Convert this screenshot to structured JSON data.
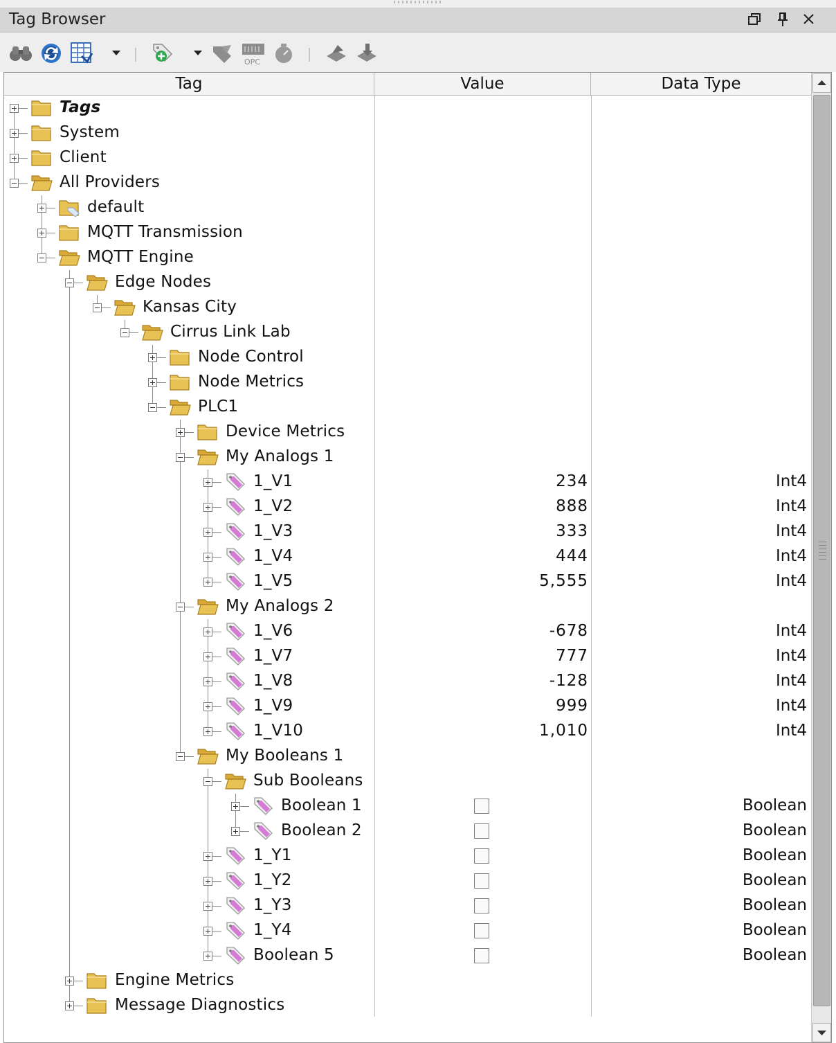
{
  "window": {
    "title": "Tag Browser"
  },
  "toolbar": {
    "buttons": [
      "binoculars-icon",
      "refresh-icon",
      "edit-table-icon",
      "add-tag-icon",
      "tag-filter-icon",
      "opc-browser-icon",
      "timer-icon",
      "import-icon",
      "export-icon"
    ]
  },
  "columns": {
    "tag": "Tag",
    "value": "Value",
    "data_type": "Data Type"
  },
  "colors": {
    "folder": "#e8c254",
    "tag_icon": "#d77ad7",
    "scrollbar": "#b7b7b7"
  },
  "rows": [
    {
      "label": "Tags",
      "depth": 0,
      "expanded": false,
      "icon": "folder",
      "italic": true
    },
    {
      "label": "System",
      "depth": 0,
      "expanded": false,
      "icon": "folder"
    },
    {
      "label": "Client",
      "depth": 0,
      "expanded": false,
      "icon": "folder"
    },
    {
      "label": "All Providers",
      "depth": 0,
      "expanded": true,
      "icon": "open-folder"
    },
    {
      "label": "default",
      "depth": 1,
      "expanded": false,
      "icon": "folder-default"
    },
    {
      "label": "MQTT Transmission",
      "depth": 1,
      "expanded": false,
      "icon": "folder"
    },
    {
      "label": "MQTT Engine",
      "depth": 1,
      "expanded": true,
      "icon": "open-folder"
    },
    {
      "label": "Edge Nodes",
      "depth": 2,
      "expanded": true,
      "icon": "open-folder"
    },
    {
      "label": "Kansas City",
      "depth": 3,
      "expanded": true,
      "icon": "open-folder"
    },
    {
      "label": "Cirrus Link Lab",
      "depth": 4,
      "expanded": true,
      "icon": "open-folder"
    },
    {
      "label": "Node Control",
      "depth": 5,
      "expanded": false,
      "icon": "folder"
    },
    {
      "label": "Node Metrics",
      "depth": 5,
      "expanded": false,
      "icon": "folder"
    },
    {
      "label": "PLC1",
      "depth": 5,
      "expanded": true,
      "icon": "open-folder"
    },
    {
      "label": "Device Metrics",
      "depth": 6,
      "expanded": false,
      "icon": "folder"
    },
    {
      "label": "My Analogs 1",
      "depth": 6,
      "expanded": true,
      "icon": "open-folder"
    },
    {
      "label": "1_V1",
      "depth": 7,
      "expanded": false,
      "icon": "tag",
      "value": "234",
      "dtype": "Int4"
    },
    {
      "label": "1_V2",
      "depth": 7,
      "expanded": false,
      "icon": "tag",
      "value": "888",
      "dtype": "Int4"
    },
    {
      "label": "1_V3",
      "depth": 7,
      "expanded": false,
      "icon": "tag",
      "value": "333",
      "dtype": "Int4"
    },
    {
      "label": "1_V4",
      "depth": 7,
      "expanded": false,
      "icon": "tag",
      "value": "444",
      "dtype": "Int4"
    },
    {
      "label": "1_V5",
      "depth": 7,
      "expanded": false,
      "icon": "tag",
      "value": "5,555",
      "dtype": "Int4"
    },
    {
      "label": "My Analogs 2",
      "depth": 6,
      "expanded": true,
      "icon": "open-folder"
    },
    {
      "label": "1_V6",
      "depth": 7,
      "expanded": false,
      "icon": "tag",
      "value": "-678",
      "dtype": "Int4"
    },
    {
      "label": "1_V7",
      "depth": 7,
      "expanded": false,
      "icon": "tag",
      "value": "777",
      "dtype": "Int4"
    },
    {
      "label": "1_V8",
      "depth": 7,
      "expanded": false,
      "icon": "tag",
      "value": "-128",
      "dtype": "Int4"
    },
    {
      "label": "1_V9",
      "depth": 7,
      "expanded": false,
      "icon": "tag",
      "value": "999",
      "dtype": "Int4"
    },
    {
      "label": "1_V10",
      "depth": 7,
      "expanded": false,
      "icon": "tag",
      "value": "1,010",
      "dtype": "Int4"
    },
    {
      "label": "My Booleans 1",
      "depth": 6,
      "expanded": true,
      "icon": "open-folder"
    },
    {
      "label": "Sub Booleans",
      "depth": 7,
      "expanded": true,
      "icon": "open-folder"
    },
    {
      "label": "Boolean 1",
      "depth": 8,
      "expanded": false,
      "icon": "tag",
      "checkbox": false,
      "dtype": "Boolean"
    },
    {
      "label": "Boolean 2",
      "depth": 8,
      "expanded": false,
      "icon": "tag",
      "checkbox": false,
      "dtype": "Boolean"
    },
    {
      "label": "1_Y1",
      "depth": 7,
      "expanded": false,
      "icon": "tag",
      "checkbox": false,
      "dtype": "Boolean"
    },
    {
      "label": "1_Y2",
      "depth": 7,
      "expanded": false,
      "icon": "tag",
      "checkbox": false,
      "dtype": "Boolean"
    },
    {
      "label": "1_Y3",
      "depth": 7,
      "expanded": false,
      "icon": "tag",
      "checkbox": false,
      "dtype": "Boolean"
    },
    {
      "label": "1_Y4",
      "depth": 7,
      "expanded": false,
      "icon": "tag",
      "checkbox": false,
      "dtype": "Boolean"
    },
    {
      "label": "Boolean 5",
      "depth": 7,
      "expanded": false,
      "icon": "tag",
      "checkbox": false,
      "dtype": "Boolean"
    },
    {
      "label": "Engine Metrics",
      "depth": 2,
      "expanded": false,
      "icon": "folder"
    },
    {
      "label": "Message Diagnostics",
      "depth": 2,
      "expanded": false,
      "icon": "folder"
    }
  ]
}
